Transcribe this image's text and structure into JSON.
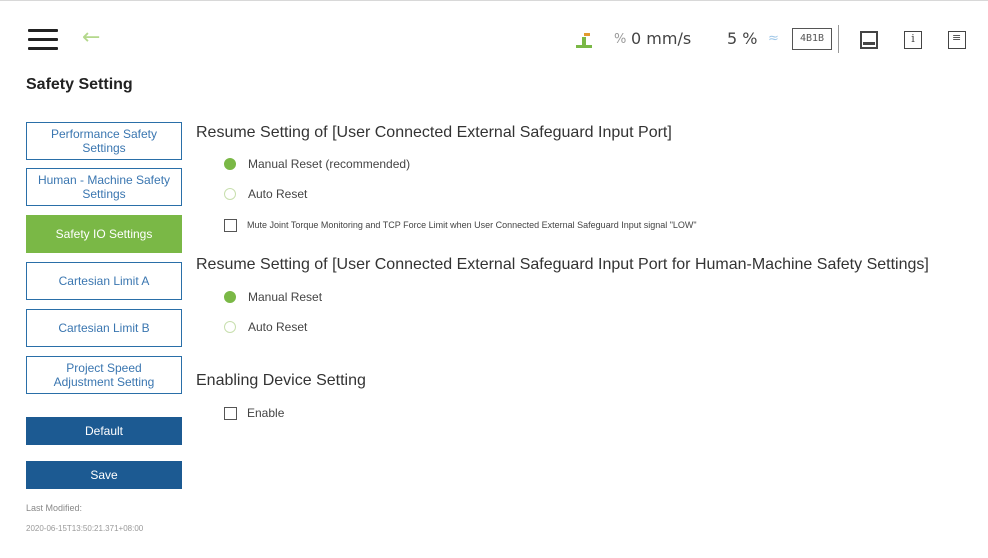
{
  "topbar": {
    "speed": "0 mm/s",
    "percent": "5 %",
    "mode_badge": "4B1B"
  },
  "page": {
    "title": "Safety Setting"
  },
  "sidebar": {
    "items": [
      {
        "label": "Performance Safety Settings"
      },
      {
        "label": "Human - Machine Safety Settings"
      },
      {
        "label": "Safety IO Settings"
      },
      {
        "label": "Cartesian Limit A"
      },
      {
        "label": "Cartesian Limit B"
      },
      {
        "label": "Project Speed Adjustment Setting"
      }
    ],
    "active_index": 2,
    "default_label": "Default",
    "save_label": "Save",
    "last_modified_label": "Last Modified:",
    "last_modified_value": "2020-06-15T13:50:21.371+08:00"
  },
  "main": {
    "section1": {
      "heading": "Resume Setting of [User Connected External Safeguard Input Port]",
      "manual": "Manual Reset (recommended)",
      "auto": "Auto Reset",
      "mute": "Mute Joint Torque Monitoring and TCP Force Limit when User Connected External Safeguard Input signal \"LOW\""
    },
    "section2": {
      "heading": "Resume Setting of [User Connected External Safeguard Input Port for Human-Machine Safety Settings]",
      "manual": "Manual Reset",
      "auto": "Auto Reset"
    },
    "section3": {
      "heading": "Enabling Device Setting",
      "enable": "Enable"
    }
  },
  "colors": {
    "accent_green": "#7ab846",
    "button_blue": "#1c5a92",
    "menu_border": "#2a6fa8"
  },
  "icons": [
    "hamburger-icon",
    "back-arrow-icon",
    "robot-status-icon",
    "speed-icon",
    "percent-icon",
    "monitor-icon",
    "info-icon",
    "log-icon"
  ]
}
